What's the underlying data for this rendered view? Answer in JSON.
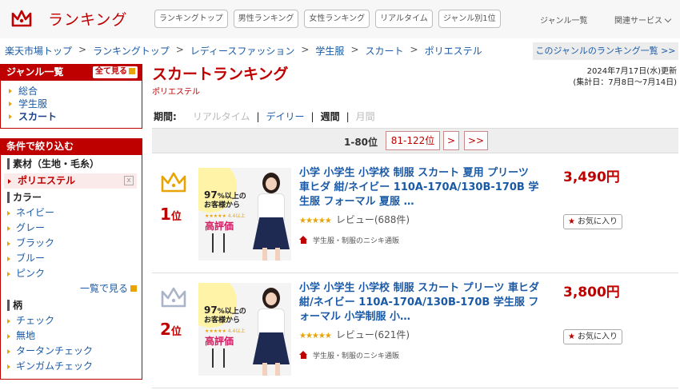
{
  "header": {
    "brand": "ランキング",
    "nav": [
      "ランキングトップ",
      "男性ランキング",
      "女性ランキング",
      "リアルタイム",
      "ジャンル別1位"
    ],
    "genre_list": "ジャンル一覧",
    "related": "関連サービス"
  },
  "breadcrumb": [
    "楽天市場トップ",
    "ランキングトップ",
    "レディースファッション",
    "学生服",
    "スカート",
    "ポリエステル"
  ],
  "breadcrumb_sep": ">",
  "genre_ranking_link": "このジャンルのランキング一覧 >>",
  "sidebar": {
    "genre_head": "ジャンル一覧",
    "see_all": "全て見る",
    "genres": [
      "総合",
      "学生服",
      "スカート"
    ],
    "filter_head": "条件で絞り込む",
    "material_label": "素材（生地・毛糸）",
    "selected_material": "ポリエステル",
    "remove_icon": "x",
    "color_label": "カラー",
    "colors": [
      "ネイビー",
      "グレー",
      "ブラック",
      "ブルー",
      "ピンク"
    ],
    "more_label": "一覧で見る",
    "pattern_label": "柄",
    "patterns": [
      "チェック",
      "無地",
      "タータンチェック",
      "ギンガムチェック"
    ]
  },
  "main": {
    "title": "スカートランキング",
    "subtitle": "ポリエステル",
    "updated": "2024年7月17日(水)更新",
    "period_range": "(集計日：7月8日〜7月14日)",
    "period_label": "期間:",
    "periods": [
      "リアルタイム",
      "デイリー",
      "週間",
      "月間"
    ],
    "period_sep": "|",
    "pager": {
      "current": "1-80位",
      "next_range": "81-122位",
      "next": ">",
      "last": ">>"
    }
  },
  "items": [
    {
      "rank": "1",
      "rank_suffix": "位",
      "crown_color": "#e8a400",
      "name": "小学 小学生 小学校 制服 スカート 夏用 プリーツ 車ヒダ 紺/ネイビー 110A-170A/130B-170B 学生服 フォーマル 夏服 …",
      "price": "3,490円",
      "stars": "★★★★★",
      "review": "レビュー(688件)",
      "shop": "学生服・制服のニシキ通販",
      "fav": "お気に入り",
      "thumb": {
        "pct": "97",
        "pct_line": "%以上の",
        "line2": "お客様から",
        "stars": "★★★★★ 4.4以上",
        "badge": "高評価"
      }
    },
    {
      "rank": "2",
      "rank_suffix": "位",
      "crown_color": "#aab4c8",
      "name": "小学 小学生 小学校 制服 スカート プリーツ 車ヒダ 紺/ネイビー 110A-170A/130B-170B 学生服 フォーマル 小学制服 小…",
      "price": "3,800円",
      "stars": "★★★★★",
      "review": "レビュー(621件)",
      "shop": "学生服・制服のニシキ通販",
      "fav": "お気に入り",
      "thumb": {
        "pct": "97",
        "pct_line": "%以上の",
        "line2": "お客様から",
        "stars": "★★★★★ 4.4以上",
        "badge": "高評価"
      }
    }
  ],
  "colors": {
    "brand_red": "#bf0000",
    "link_blue": "#1a5aa6",
    "gold": "#e8a400",
    "silver": "#aab4c8"
  }
}
